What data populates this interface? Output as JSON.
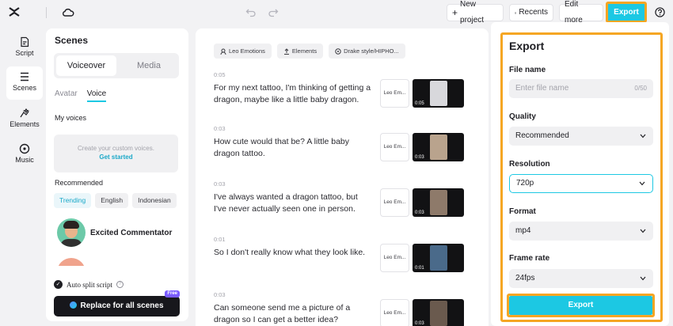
{
  "topbar": {
    "new_project_label": "New project",
    "recents_label": "Recents",
    "edit_more_label": "Edit more",
    "export_label": "Export"
  },
  "rail": {
    "items": [
      {
        "label": "Script",
        "icon": "script-icon",
        "active": false
      },
      {
        "label": "Scenes",
        "icon": "scenes-icon",
        "active": true
      },
      {
        "label": "Elements",
        "icon": "elements-icon",
        "active": false
      },
      {
        "label": "Music",
        "icon": "music-icon",
        "active": false
      }
    ]
  },
  "scenes_panel": {
    "title": "Scenes",
    "segment": {
      "voiceover": "Voiceover",
      "media": "Media"
    },
    "subtabs": {
      "avatar": "Avatar",
      "voice": "Voice"
    },
    "my_voices_label": "My voices",
    "custom_hint": "Create your custom voices.",
    "get_started": "Get started",
    "recommended_label": "Recommended",
    "chips": [
      "Trending",
      "English",
      "Indonesian"
    ],
    "voice_name": "Excited Commentator",
    "auto_split_label": "Auto split script",
    "replace_label": "Replace for all scenes",
    "free_badge": "Free"
  },
  "script_panel": {
    "tools": [
      "Leo Emotions",
      "Elements",
      "Drake style/HIPHO..."
    ],
    "scenes": [
      {
        "time": "0:05",
        "text": "For my next tattoo, I'm thinking of getting a dragon, maybe like a little baby dragon.",
        "avatar": "Leo Em...",
        "duration": "0:05",
        "thumb_color": "#d8d8dc"
      },
      {
        "time": "0:03",
        "text": "How cute would that be? A little baby dragon tattoo.",
        "avatar": "Leo Em...",
        "duration": "0:03",
        "thumb_color": "#b9a38d"
      },
      {
        "time": "0:03",
        "text": "I've always wanted a dragon tattoo, but I've never actually seen one in person.",
        "avatar": "Leo Em...",
        "duration": "0:03",
        "thumb_color": "#8e7a6a"
      },
      {
        "time": "0:01",
        "text": "So I don't really know what they look like.",
        "avatar": "Leo Em...",
        "duration": "0:01",
        "thumb_color": "#4a6a8a"
      },
      {
        "time": "0:03",
        "text": "Can someone send me a picture of a dragon so I can get a better idea?",
        "avatar": "Leo Em...",
        "duration": "0:03",
        "thumb_color": "#6a5a4e"
      }
    ]
  },
  "export_panel": {
    "title": "Export",
    "file_name_label": "File name",
    "file_name_placeholder": "Enter file name",
    "file_name_count": "0/50",
    "quality_label": "Quality",
    "quality_value": "Recommended",
    "resolution_label": "Resolution",
    "resolution_value": "720p",
    "format_label": "Format",
    "format_value": "mp4",
    "frame_rate_label": "Frame rate",
    "frame_rate_value": "24fps",
    "export_button": "Export"
  },
  "colors": {
    "accent": "#1cc8e3",
    "highlight": "#f5a623",
    "dark_button": "#17171c"
  }
}
